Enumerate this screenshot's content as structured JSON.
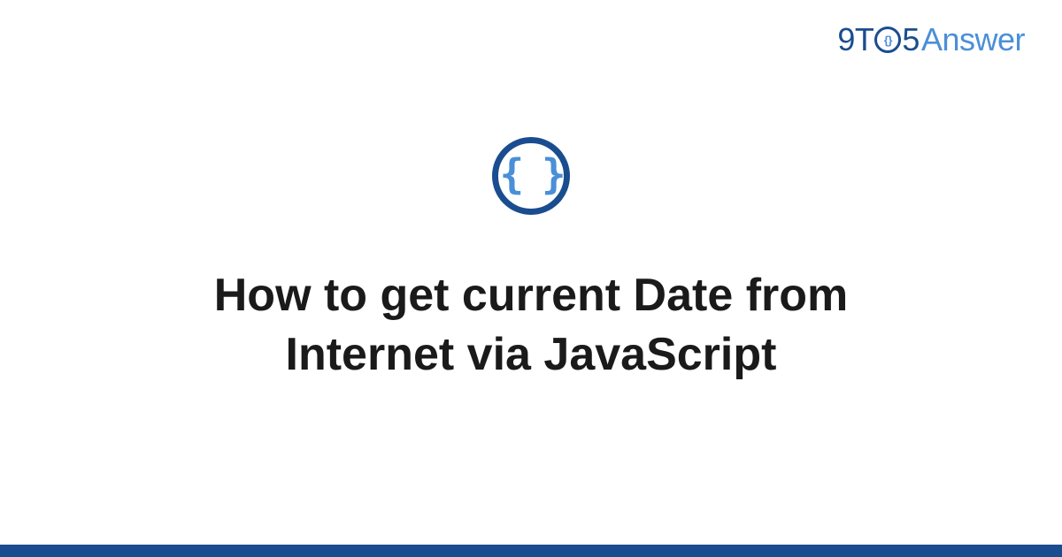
{
  "logo": {
    "part_9t": "9T",
    "part_5": "5",
    "part_answer": "Answer"
  },
  "badge": {
    "icon_name": "code-braces-icon",
    "glyph": "{ }"
  },
  "title": "How to get current Date from Internet via JavaScript",
  "colors": {
    "brand_dark": "#1a4d8f",
    "brand_light": "#4a8fd8",
    "text": "#1a1a1a",
    "background": "#ffffff"
  }
}
